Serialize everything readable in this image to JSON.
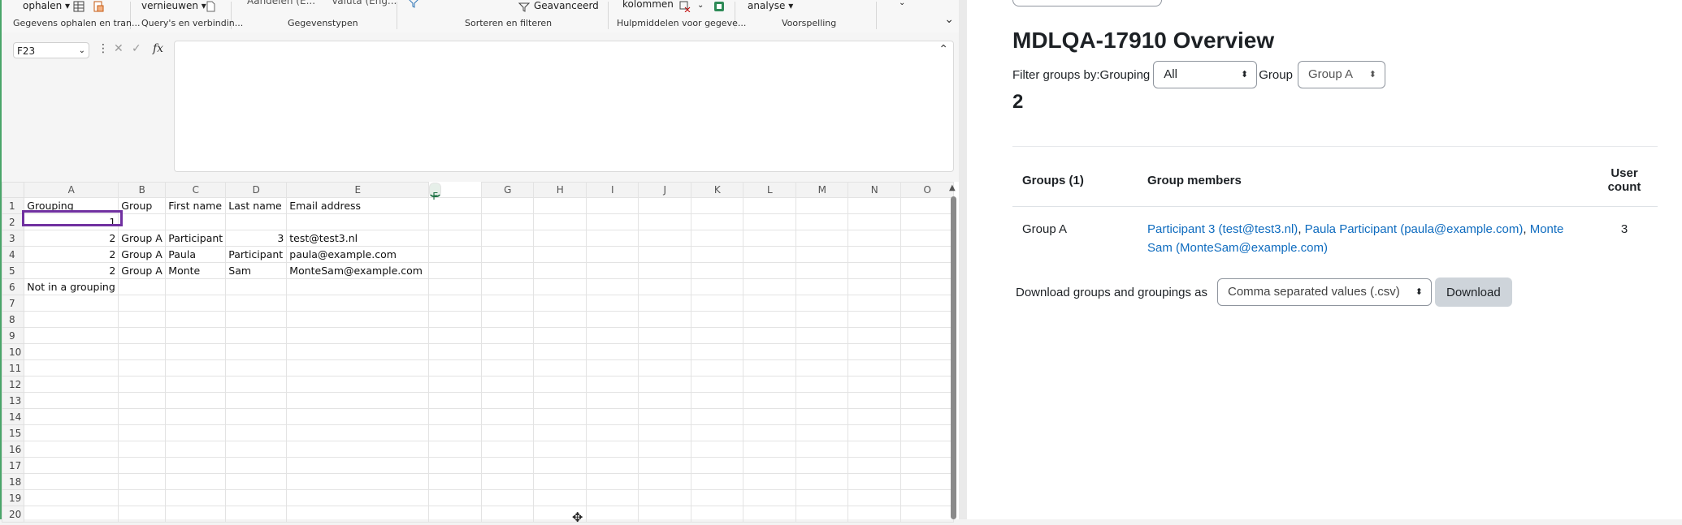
{
  "excel": {
    "ribbon": {
      "top_items": [
        "ophalen ▾",
        "vernieuwen ▾",
        "Aandelen (E...",
        "Valuta (Eng...",
        "Geavanceerd",
        "kolommen",
        "analyse ▾"
      ],
      "groups": [
        "Gegevens ophalen en tran...",
        "Query's en verbindin...",
        "Gegevenstypen",
        "Sorteren en filteren",
        "Hulpmiddelen voor gegeve...",
        "Voorspelling"
      ]
    },
    "name_box": "F23",
    "fx_label": "fx",
    "columns": [
      "A",
      "B",
      "C",
      "D",
      "E",
      "F",
      "G",
      "H",
      "I",
      "J",
      "K",
      "L",
      "M",
      "N",
      "O"
    ],
    "selected_column": "F",
    "rows": [
      {
        "n": "1",
        "cells": [
          "Grouping",
          "Group",
          "First name",
          "Last name",
          "Email address"
        ]
      },
      {
        "n": "2",
        "cells": [
          "1",
          "",
          "",
          "",
          ""
        ]
      },
      {
        "n": "3",
        "cells": [
          "2",
          "Group A",
          "Participant",
          "3",
          "test@test3.nl"
        ]
      },
      {
        "n": "4",
        "cells": [
          "2",
          "Group A",
          "Paula",
          "Participant",
          "paula@example.com"
        ]
      },
      {
        "n": "5",
        "cells": [
          "2",
          "Group A",
          "Monte",
          "Sam",
          "MonteSam@example.com"
        ]
      },
      {
        "n": "6",
        "cells": [
          "Not in a grouping",
          "",
          "",
          "",
          ""
        ]
      },
      {
        "n": "7",
        "cells": []
      },
      {
        "n": "8",
        "cells": []
      },
      {
        "n": "9",
        "cells": []
      },
      {
        "n": "10",
        "cells": []
      },
      {
        "n": "11",
        "cells": []
      },
      {
        "n": "12",
        "cells": []
      },
      {
        "n": "13",
        "cells": []
      },
      {
        "n": "14",
        "cells": []
      },
      {
        "n": "15",
        "cells": []
      },
      {
        "n": "16",
        "cells": []
      },
      {
        "n": "17",
        "cells": []
      },
      {
        "n": "18",
        "cells": []
      },
      {
        "n": "19",
        "cells": []
      },
      {
        "n": "20",
        "cells": []
      }
    ]
  },
  "web": {
    "title": "MDLQA-17910 Overview",
    "filter_label": "Filter groups by:",
    "grouping_label": "Grouping",
    "grouping_value": "All",
    "group_label": "Group",
    "group_value": "Group A",
    "count": "2",
    "table": {
      "headers": [
        "Groups (1)",
        "Group members",
        "User count"
      ],
      "rows": [
        {
          "group": "Group A",
          "members": [
            "Participant 3 (test@test3.nl)",
            "Paula Participant (paula@example.com)",
            "Monte Sam (MonteSam@example.com)"
          ],
          "user_count": "3"
        }
      ]
    },
    "download_label": "Download groups and groupings as",
    "download_format": "Comma separated values (.csv)",
    "download_button": "Download"
  }
}
